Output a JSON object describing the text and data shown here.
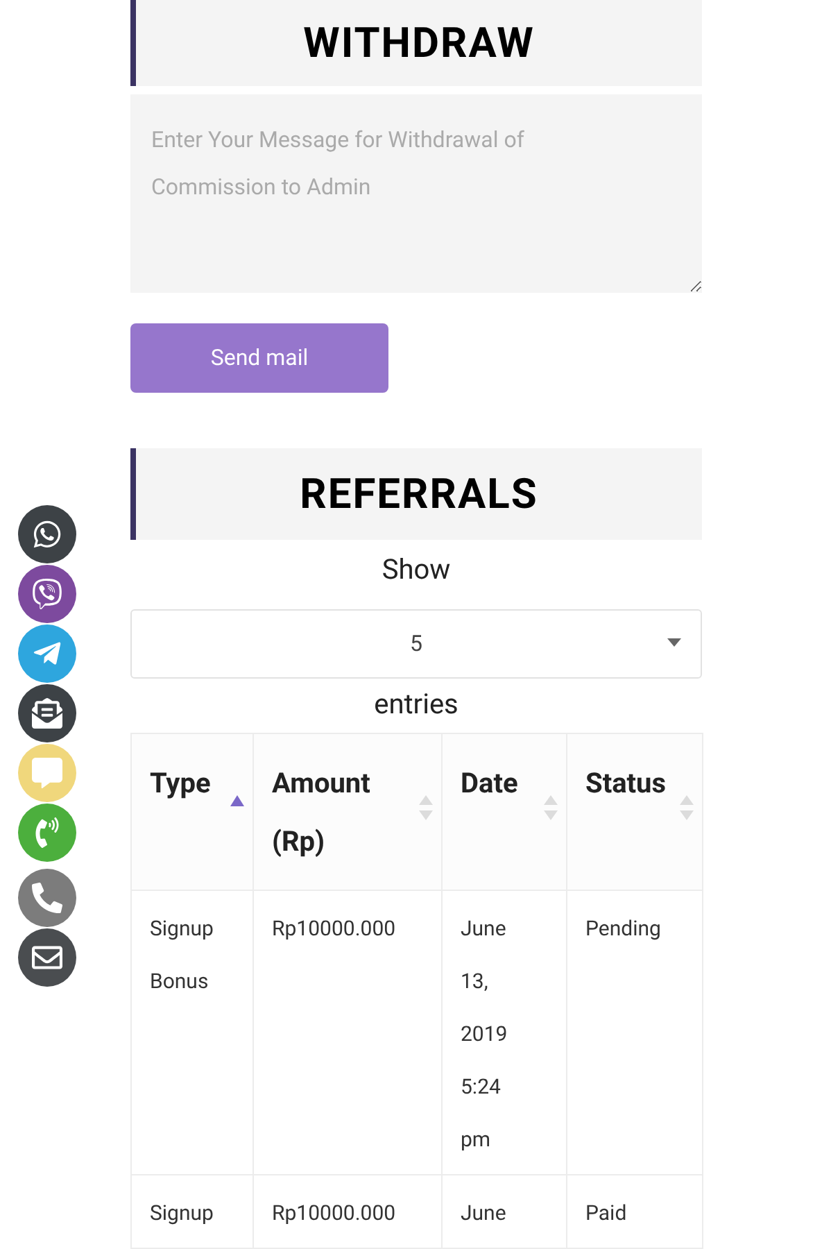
{
  "withdraw": {
    "title": "WITHDRAW",
    "message_field": {
      "placeholder": "Enter Your Message for Withdrawal of Commission to Admin"
    },
    "send_button": "Send mail"
  },
  "referrals": {
    "title": "REFERRALS",
    "show_label": "Show",
    "page_size": "5",
    "entries_label": "entries",
    "table": {
      "columns": [
        {
          "label": "Type",
          "sorted": true
        },
        {
          "label": "Amount (Rp)",
          "sorted": false
        },
        {
          "label": "Date",
          "sorted": false
        },
        {
          "label": "Status",
          "sorted": false
        }
      ],
      "rows": [
        [
          "Signup Bonus",
          "Rp10000.000",
          "June 13, 2019 5:24 pm",
          "Pending"
        ],
        [
          "Signup",
          "Rp10000.000",
          "June",
          "Paid"
        ]
      ]
    }
  },
  "contact_buttons": [
    {
      "kind": "whatsapp",
      "color": "#3d4246"
    },
    {
      "kind": "viber",
      "color": "#7d4a9e"
    },
    {
      "kind": "telegram",
      "color": "#2ea6de"
    },
    {
      "kind": "mail-open",
      "color": "#3d4246"
    },
    {
      "kind": "chat",
      "color": "#f0d77c"
    },
    {
      "kind": "call-sound",
      "color": "#4caf3d"
    },
    {
      "kind": "phone",
      "color": "#7c7c7c"
    },
    {
      "kind": "mail",
      "color": "#4a4d50"
    }
  ]
}
